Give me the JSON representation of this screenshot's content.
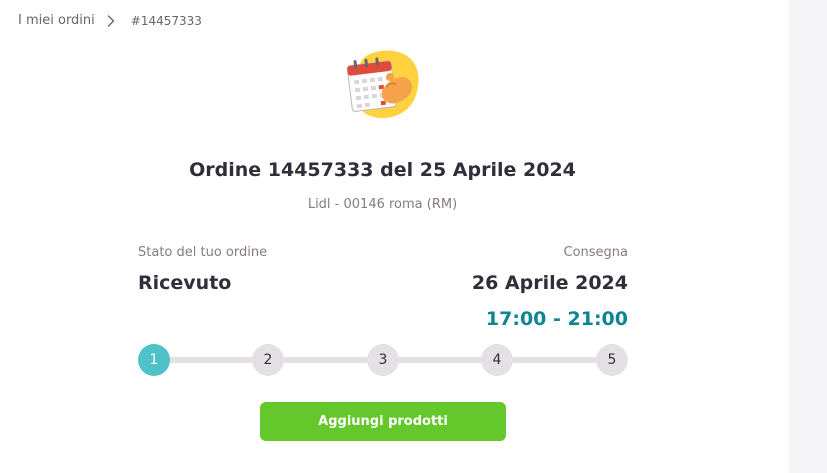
{
  "breadcrumb": {
    "parent": "I miei ordini",
    "current": "#14457333"
  },
  "order": {
    "title": "Ordine 14457333 del 25 Aprile 2024",
    "store": "Lidl - 00146 roma (RM)"
  },
  "status": {
    "label": "Stato del tuo ordine",
    "value": "Ricevuto"
  },
  "delivery": {
    "label": "Consegna",
    "date": "26 Aprile 2024",
    "time": "17:00 - 21:00"
  },
  "progress": {
    "steps": [
      "1",
      "2",
      "3",
      "4",
      "5"
    ],
    "current_step": 1
  },
  "actions": {
    "add_products": "Aggiungi prodotti"
  },
  "colors": {
    "accent_teal": "#4ec2c8",
    "time_teal": "#0f8492",
    "button_green": "#64c72c",
    "illustration_yellow": "#fdd23e"
  },
  "icons": {
    "breadcrumb_separator": "chevron-right-icon",
    "illustration": "calendar-hand-illustration"
  }
}
